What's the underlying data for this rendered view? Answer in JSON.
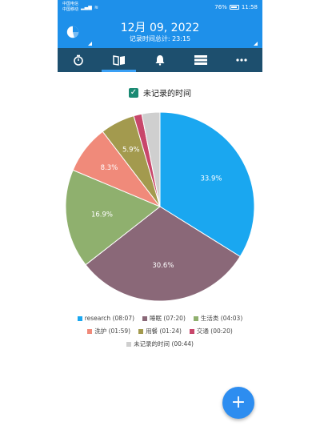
{
  "status_bar": {
    "carrier1": "中国电信",
    "carrier2": "中国移动",
    "battery": "76%",
    "time": "11:58"
  },
  "header": {
    "date": "12月 09, 2022",
    "total_label": "记录时间总计: 23:15"
  },
  "tabs": [
    {
      "icon": "stopwatch-icon",
      "glyph": "⏱"
    },
    {
      "icon": "book-icon",
      "glyph": "📖"
    },
    {
      "icon": "bell-icon",
      "glyph": "🔔"
    },
    {
      "icon": "list-icon",
      "glyph": "☰"
    },
    {
      "icon": "more-icon",
      "glyph": "•••"
    }
  ],
  "filter": {
    "label": "未记录的时间",
    "checked": true
  },
  "chart_data": {
    "type": "pie",
    "series": [
      {
        "name": "research (08:07)",
        "value": 33.9,
        "label": "33.9%",
        "color": "#1aa7f0"
      },
      {
        "name": "睡眠 (07:20)",
        "value": 30.6,
        "label": "30.6%",
        "color": "#8a6878"
      },
      {
        "name": "生活类 (04:03)",
        "value": 16.9,
        "label": "16.9%",
        "color": "#8fb06e"
      },
      {
        "name": "洗护 (01:59)",
        "value": 8.3,
        "label": "8.3%",
        "color": "#f08a7a"
      },
      {
        "name": "用餐 (01:24)",
        "value": 5.9,
        "label": "5.9%",
        "color": "#a39a4e"
      },
      {
        "name": "交通 (00:20)",
        "value": 1.4,
        "label": "",
        "color": "#c8476b"
      },
      {
        "name": "未记录的时间 (00:44)",
        "value": 3.1,
        "label": "",
        "color": "#cfcfcf"
      }
    ],
    "legend_placement": "bottom"
  },
  "legend_rows": [
    [
      0,
      1,
      2
    ],
    [
      3,
      4,
      5
    ],
    [
      6
    ]
  ],
  "fab": {
    "label": "+"
  }
}
